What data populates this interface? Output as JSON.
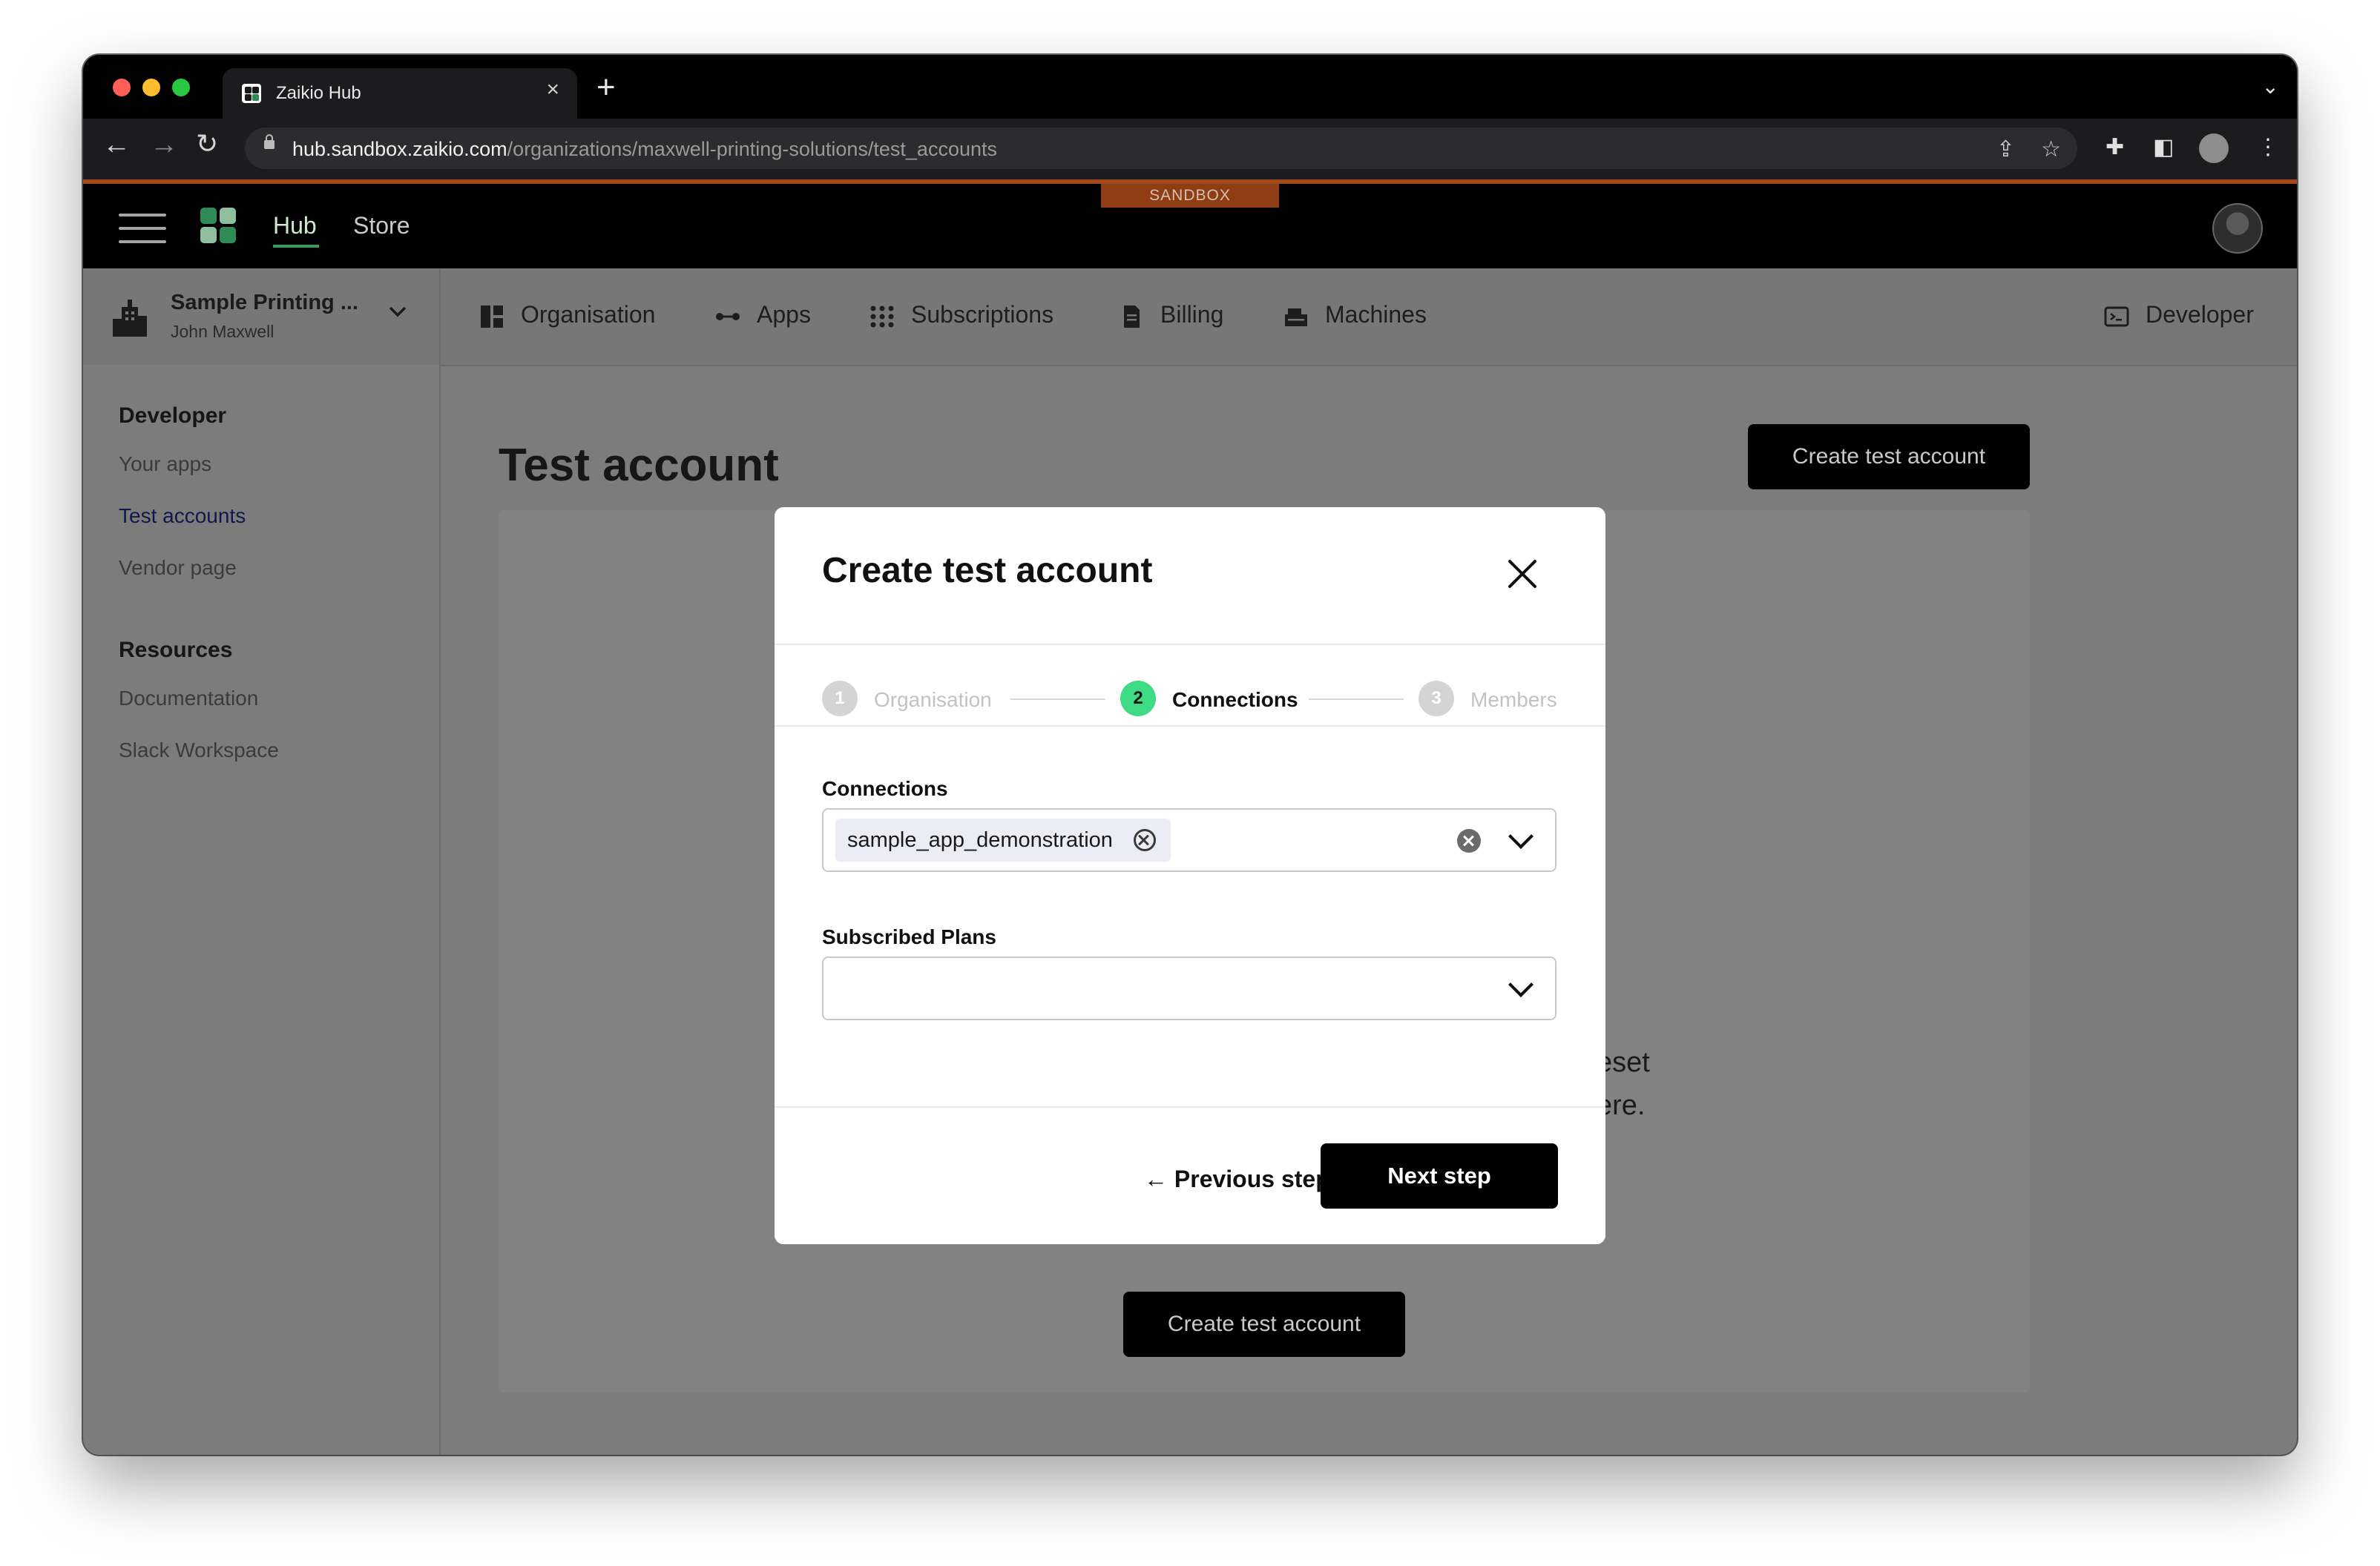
{
  "browser": {
    "tab_title": "Zaikio Hub",
    "url_host": "hub.sandbox.zaikio.com",
    "url_path": "/organizations/maxwell-printing-solutions/test_accounts"
  },
  "app": {
    "sandbox_label": "SANDBOX",
    "top_links": [
      "Hub",
      "Store"
    ],
    "org_name": "Sample Printing ...",
    "org_user": "John Maxwell",
    "nav": {
      "organisation": "Organisation",
      "apps": "Apps",
      "subscriptions": "Subscriptions",
      "billing": "Billing",
      "machines": "Machines",
      "developer": "Developer"
    }
  },
  "sidebar": {
    "developer_heading": "Developer",
    "developer_items": [
      "Your apps",
      "Test accounts",
      "Vendor page"
    ],
    "resources_heading": "Resources",
    "resources_items": [
      "Documentation",
      "Slack Workspace"
    ]
  },
  "main": {
    "title": "Test account",
    "create_button": "Create test account",
    "empty_text_line1": "eset",
    "empty_text_line2": "ere.",
    "create_button_center": "Create test account"
  },
  "modal": {
    "title": "Create test account",
    "steps": [
      {
        "num": "1",
        "label": "Organisation",
        "state": "done"
      },
      {
        "num": "2",
        "label": "Connections",
        "state": "active"
      },
      {
        "num": "3",
        "label": "Members",
        "state": "upcoming"
      }
    ],
    "connections_label": "Connections",
    "connections_selected": "sample_app_demonstration",
    "plans_label": "Subscribed Plans",
    "plans_value": "",
    "prev_button": "← Previous step",
    "next_button": "Next step"
  },
  "colors": {
    "active_step": "#3ddc84",
    "sandbox_badge": "#8e3d14",
    "primary_button": "#000000"
  }
}
